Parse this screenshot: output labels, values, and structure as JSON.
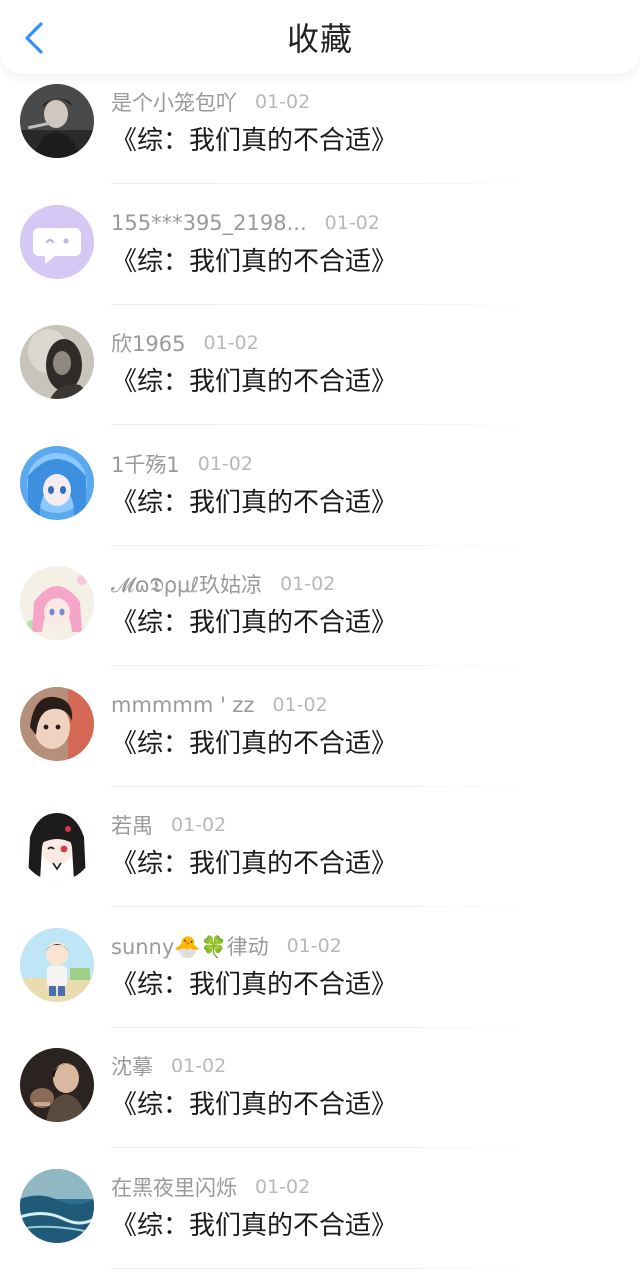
{
  "header": {
    "title": "收藏",
    "back_icon": "chevron-left-icon",
    "accent_color": "#2f8fff"
  },
  "items": [
    {
      "username": "是个小笼包吖",
      "date": "01-02",
      "title": "《综：我们真的不合适》"
    },
    {
      "username": "155***395_2198...",
      "date": "01-02",
      "title": "《综：我们真的不合适》"
    },
    {
      "username": "欣1965",
      "date": "01-02",
      "title": "《综：我们真的不合适》"
    },
    {
      "username": "1千殇1",
      "date": "01-02",
      "title": "《综：我们真的不合适》"
    },
    {
      "username": "𝓜ɷ𝕯ρμℓ玖姑凉",
      "date": "01-02",
      "title": "《综：我们真的不合适》"
    },
    {
      "username": "mmmmm ' zz",
      "date": "01-02",
      "title": "《综：我们真的不合适》"
    },
    {
      "username": "若禺",
      "date": "01-02",
      "title": "《综：我们真的不合适》"
    },
    {
      "username": "sunny🐣🍀律动",
      "date": "01-02",
      "title": "《综：我们真的不合适》"
    },
    {
      "username": "沈摹",
      "date": "01-02",
      "title": "《综：我们真的不合适》"
    },
    {
      "username": "在黑夜里闪烁",
      "date": "01-02",
      "title": "《综：我们真的不合适》"
    }
  ]
}
